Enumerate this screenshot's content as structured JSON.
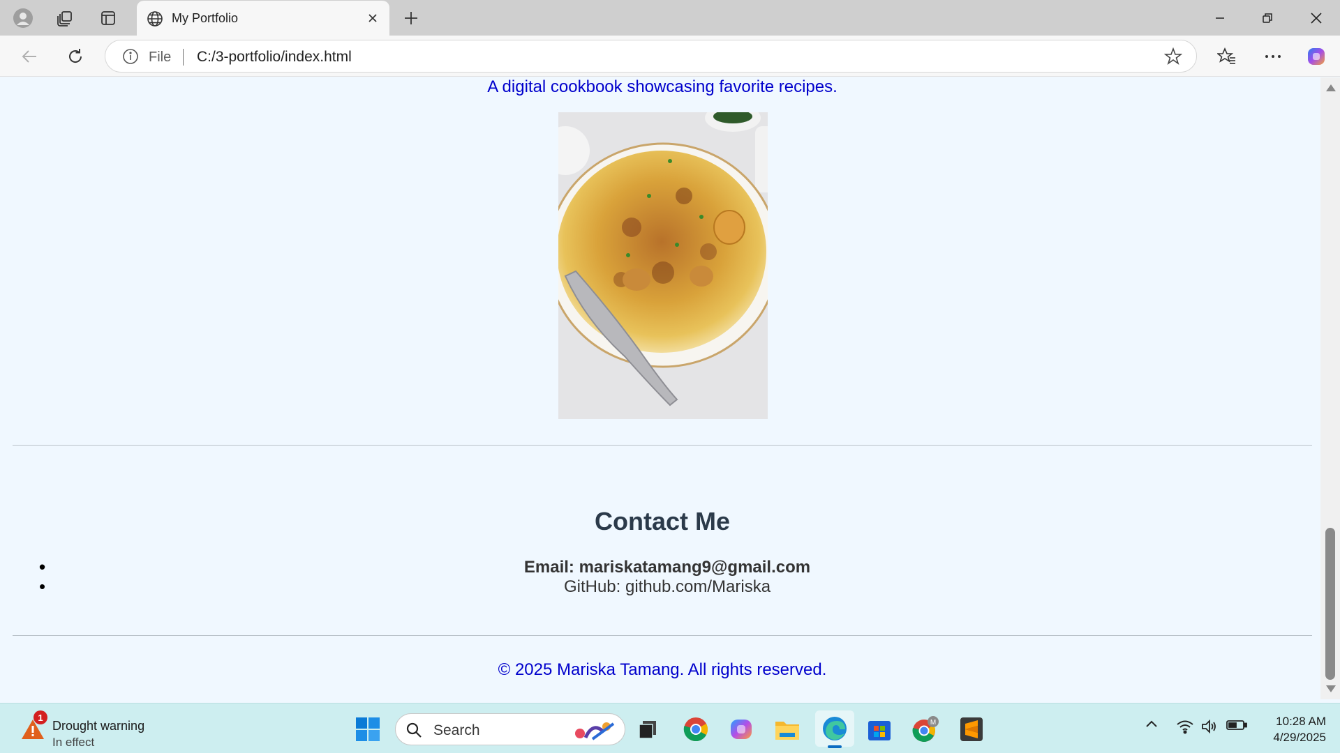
{
  "browser": {
    "tab_title": "My Portfolio",
    "address_scheme": "File",
    "address_url": "C:/3-portfolio/index.html"
  },
  "page": {
    "tagline": "A digital cookbook showcasing favorite recipes.",
    "contact": {
      "title": "Contact Me",
      "items": [
        "Email: mariskatamang9@gmail.com",
        "GitHub: github.com/Mariska"
      ]
    },
    "footer": "© 2025 Mariska Tamang. All rights reserved."
  },
  "taskbar": {
    "weather_title": "Drought warning",
    "weather_subtitle": "In effect",
    "weather_badge": "1",
    "search_placeholder": "Search",
    "time": "10:28 AM",
    "date": "4/29/2025",
    "apps": [
      "start-icon",
      "task-view-icon",
      "chrome-icon",
      "copilot-icon",
      "file-explorer-icon",
      "edge-icon",
      "microsoft-store-icon",
      "chrome-profile-icon",
      "sublime-text-icon"
    ]
  },
  "colors": {
    "page_background": "#f0f8ff",
    "accent_blue": "#0000cc",
    "heading": "#2b3a4a",
    "taskbar": "#cdeef0"
  }
}
